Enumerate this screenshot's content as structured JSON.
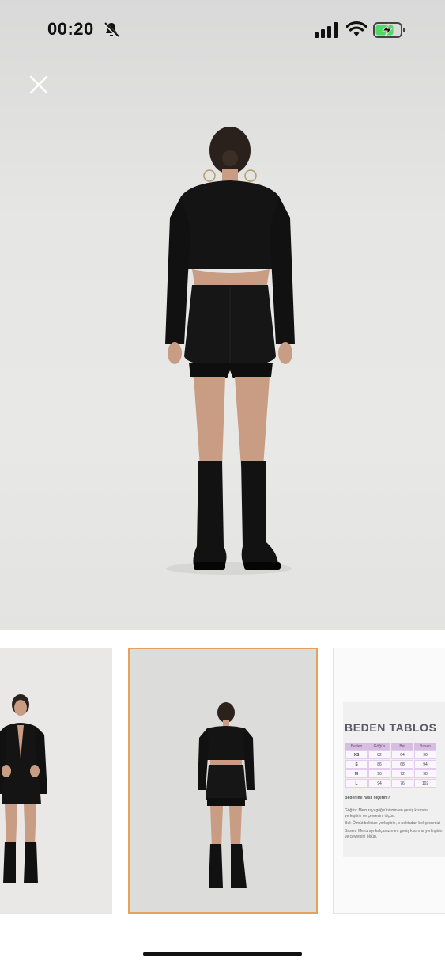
{
  "status_bar": {
    "time": "00:20",
    "icons": [
      "bell-slash-icon",
      "cellular-signal-icon",
      "wifi-icon",
      "battery-charging-icon"
    ]
  },
  "viewer": {
    "close_icon": "close-icon",
    "main_image": "model-black-cropped-blazer-back-view"
  },
  "thumbnails": [
    {
      "content": "model-black-blazer-front-view",
      "selected": false
    },
    {
      "content": "model-black-cropped-blazer-back-view",
      "selected": true
    },
    {
      "content": "size-chart",
      "selected": false
    }
  ],
  "size_chart": {
    "title": "BEDEN TABLOS",
    "headers": [
      "Beden",
      "Göğüs",
      "Bel",
      "Basen"
    ],
    "rows": [
      [
        "XS",
        "82",
        "64",
        "90"
      ],
      [
        "S",
        "86",
        "68",
        "94"
      ],
      [
        "M",
        "90",
        "72",
        "98"
      ],
      [
        "L",
        "94",
        "76",
        "102"
      ]
    ],
    "howto_title": "Bedenimi nasıl ölçerim?",
    "notes": [
      "Göğüs: Mezurayı göğsünüzün en geniş kısmına",
      "yerleştirin ve çevresini ölçün.",
      "Bel: Ölmüt belinize yerleştirin, o noktadan bel çevrenizi",
      "Basen: Mezurayı kalçanızın en geniş kısmına yerleştirin",
      "ve çevresini ölçün."
    ]
  },
  "colors": {
    "selected_border": "#e8a15a",
    "size_chart_header": "#d7bde0",
    "title_text": "#5a5a66"
  }
}
